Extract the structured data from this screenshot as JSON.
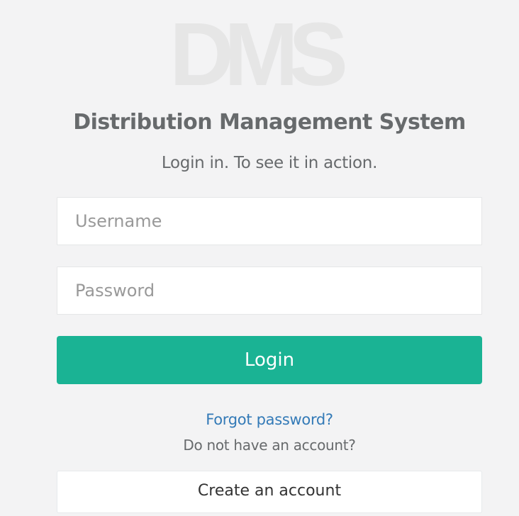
{
  "logo": {
    "text": "DMS"
  },
  "header": {
    "title": "Distribution Management System",
    "subtitle": "Login in. To see it in action."
  },
  "form": {
    "username_placeholder": "Username",
    "username_value": "",
    "password_placeholder": "Password",
    "password_value": "",
    "login_label": "Login"
  },
  "links": {
    "forgot_password": "Forgot password?",
    "no_account": "Do not have an account?",
    "create_account": "Create an account"
  },
  "colors": {
    "background": "#f3f3f4",
    "primary_button": "#1ab394",
    "link": "#337ab7",
    "text": "#676a6c",
    "logo": "#e6e6e6"
  }
}
